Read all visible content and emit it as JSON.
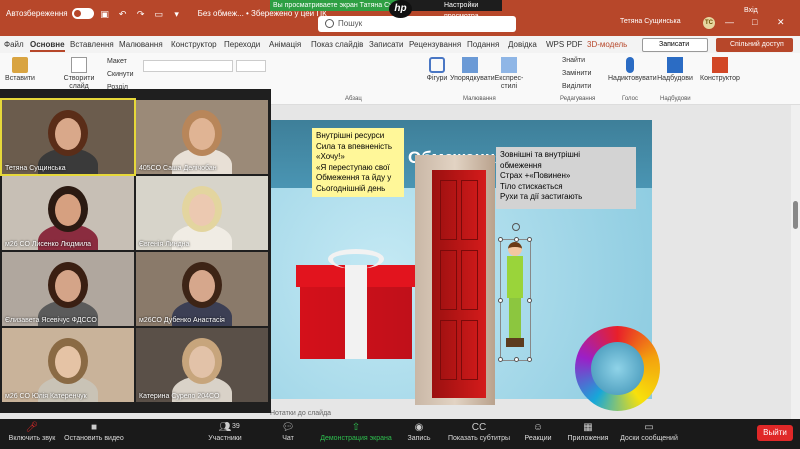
{
  "zoom_banner": {
    "viewing": "Вы просматриваете экран Татяна Сущинська",
    "view_options": "Настройки просмотра"
  },
  "ppt": {
    "autosave": "Автозбереження",
    "doc_title": "Без обмеж... • Збережено у цей ПК",
    "search_placeholder": "Пошук",
    "user": "Тетяна Сущинська",
    "user_initials": "ТС",
    "login": "Вхід",
    "tabs": [
      "Файл",
      "Основне",
      "Вставлення",
      "Малювання",
      "Конструктор",
      "Переходи",
      "Анімація",
      "Показ слайдів",
      "Записати",
      "Рецензування",
      "Подання",
      "Довідка",
      "WPS PDF",
      "3D-модель"
    ],
    "record_btn": "Записати",
    "share_btn": "Спільний доступ",
    "ribbon": {
      "paste": "Вставити",
      "new_slide": "Створити слайд",
      "layout": "Макет",
      "reset": "Скинути",
      "section": "Розділ",
      "group_paragraph": "Абзац",
      "group_drawing": "Малювання",
      "group_editing": "Редагування",
      "group_voice": "Голос",
      "group_addins": "Надбудови",
      "shapes": "Фігури",
      "arrange": "Упорядкувати",
      "quick_styles": "Експрес-стилі",
      "find": "Знайти",
      "replace": "Замінити",
      "select": "Виділити",
      "dictate": "Надиктовувати",
      "addins": "Надбудови",
      "designer": "Конструктор"
    }
  },
  "slide": {
    "title": "Обмеження",
    "note_yellow": [
      "Внутрішні ресурси",
      "Сила та впевненість",
      "«Хочу!»",
      "«Я переступаю свої",
      "Обмеження та йду у",
      "Сьогоднішній день"
    ],
    "note_gray": [
      "Зовнішні та внутрішні",
      "обмеження",
      "Страх +«Повинен»",
      "Тіло стискається",
      "Рухи та дії застигають"
    ],
    "notes_hint": "Нотатки до слайда"
  },
  "participants": [
    {
      "name": "Тетяна Сущинська",
      "bg": "#6b5c4d",
      "skin": "#d9a88a",
      "hair": "#5a2d18",
      "shirt": "#3a3a3a"
    },
    {
      "name": "405СО Саша Делічобан",
      "bg": "#9b8a78",
      "skin": "#e0b494",
      "hair": "#b8865a",
      "shirt": "#e8e0d6"
    },
    {
      "name": "м26 СО Лисенко Людмила",
      "bg": "#c7bfb5",
      "skin": "#d6a080",
      "hair": "#2b1a12",
      "shirt": "#8a2c3f"
    },
    {
      "name": "Євгенія Линдна",
      "bg": "#d7d4ca",
      "skin": "#ecc9b1",
      "hair": "#e3d59f",
      "shirt": "#f0ece4"
    },
    {
      "name": "Єлизавета Ясевічус ФДССО",
      "bg": "#b0a79e",
      "skin": "#d4a488",
      "hair": "#3a1f12",
      "shirt": "#5b5b5b"
    },
    {
      "name": "м26СО Дубенко Анастасія",
      "bg": "#8a7a6a",
      "skin": "#d6a78c",
      "hair": "#3d2416",
      "shirt": "#3c3f54"
    },
    {
      "name": "м26 СО Юлія Катеренчук",
      "bg": "#c9b39a",
      "skin": "#e5c3a5",
      "hair": "#8a6a44",
      "shirt": "#c9c3b6"
    },
    {
      "name": "Катерина Сурело 204СО",
      "bg": "#5a5048",
      "skin": "#e2c2a8",
      "hair": "#c7a57c",
      "shirt": "#d9d2c8"
    }
  ],
  "toolbar": {
    "mute": "Включить звук",
    "video": "Остановить видео",
    "participants": "Участники",
    "participants_count": "39",
    "chat": "Чат",
    "share": "Демонстрация экрана",
    "record": "Запись",
    "captions": "Показать субтитры",
    "reactions": "Реакции",
    "apps": "Приложения",
    "whiteboards": "Доски сообщений",
    "leave": "Выйти"
  }
}
